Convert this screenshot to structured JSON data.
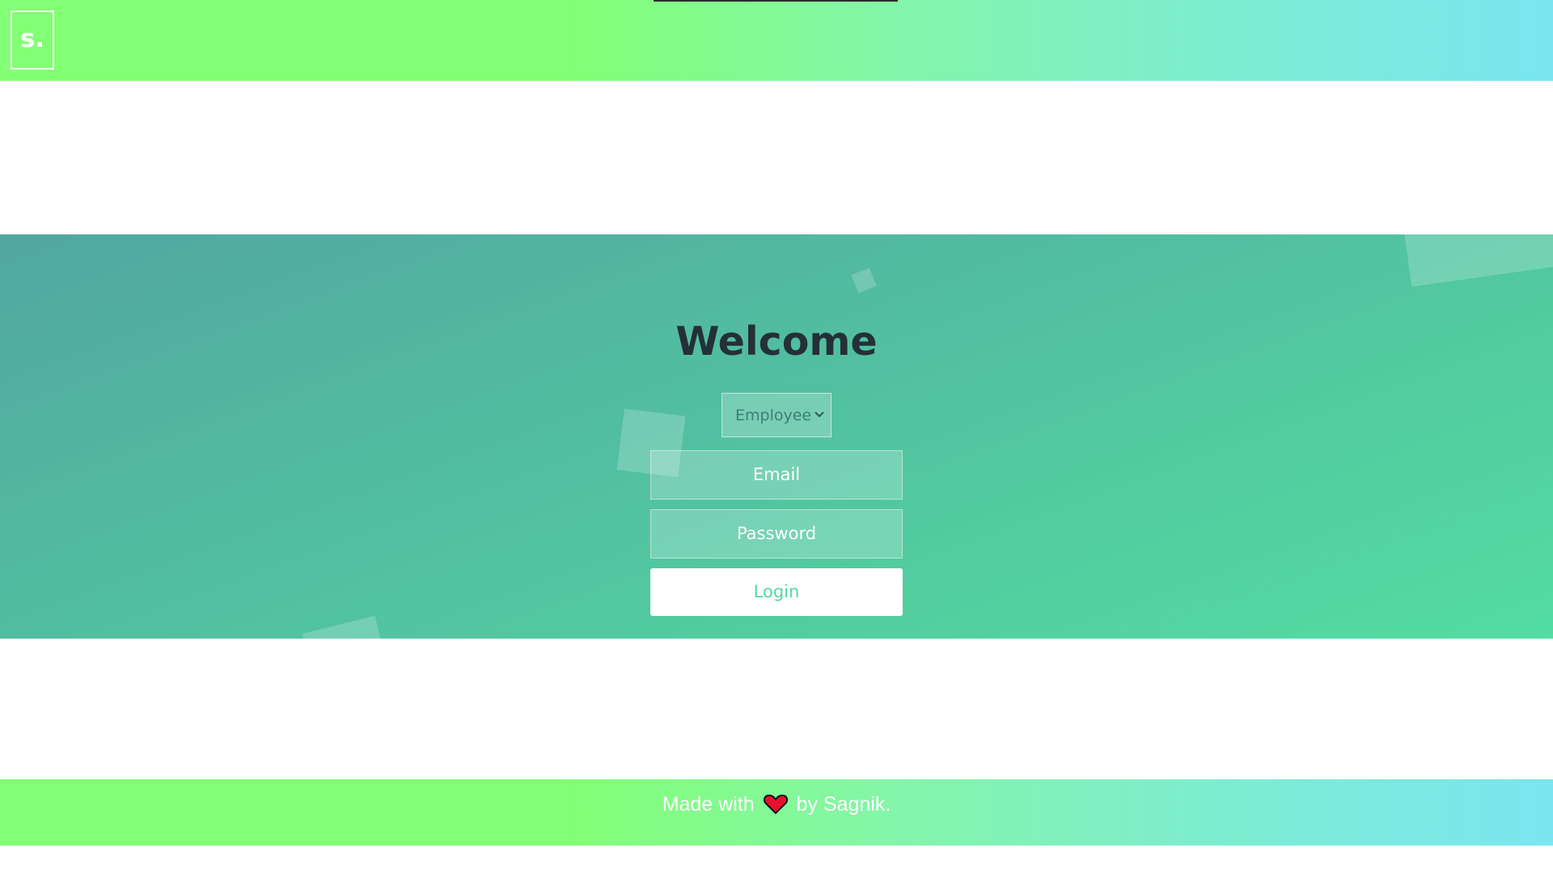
{
  "header": {
    "logo_text": "s."
  },
  "login": {
    "title": "Welcome",
    "role_select": {
      "selected": "Employee",
      "options": [
        "Employee"
      ]
    },
    "email_placeholder": "Email",
    "password_placeholder": "Password",
    "login_label": "Login"
  },
  "footer": {
    "prefix": "Made with",
    "icon": "heart-icon",
    "suffix": "by Sagnik."
  },
  "colors": {
    "header_gradient": [
      "#82ff74",
      "#7ae5f0"
    ],
    "band_gradient": [
      "#52a7a0",
      "#53dda1"
    ],
    "title": "#243039",
    "login_text": "#53d9a3",
    "heart": "#e8112d"
  }
}
